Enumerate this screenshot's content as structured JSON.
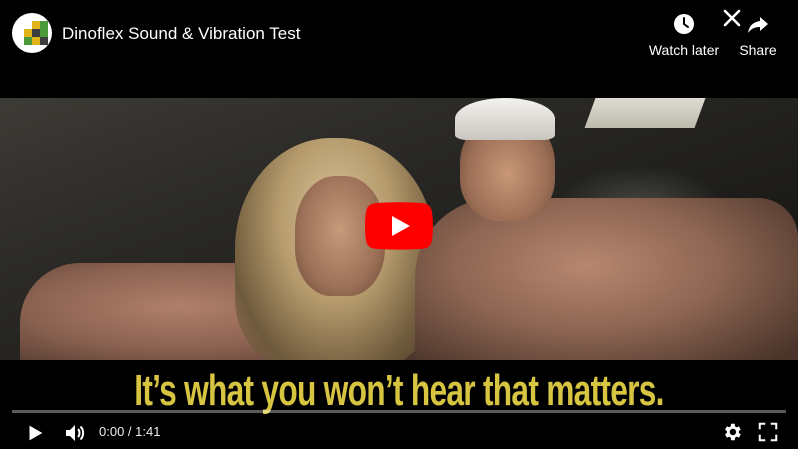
{
  "video": {
    "title": "Dinoflex Sound & Vibration Test",
    "caption": "It’s what you won’t hear that matters.",
    "progress": 0.0
  },
  "actions": {
    "watch_later_label": "Watch later",
    "share_label": "Share"
  },
  "controls": {
    "current_time": "0:00",
    "separator": " / ",
    "duration": "1:41"
  },
  "colors": {
    "accent": "#ff0000",
    "caption": "#d7c542",
    "avatar_green": "#4a9a3c",
    "avatar_yellow": "#e0b51c",
    "avatar_dark": "#3d3d3d"
  }
}
